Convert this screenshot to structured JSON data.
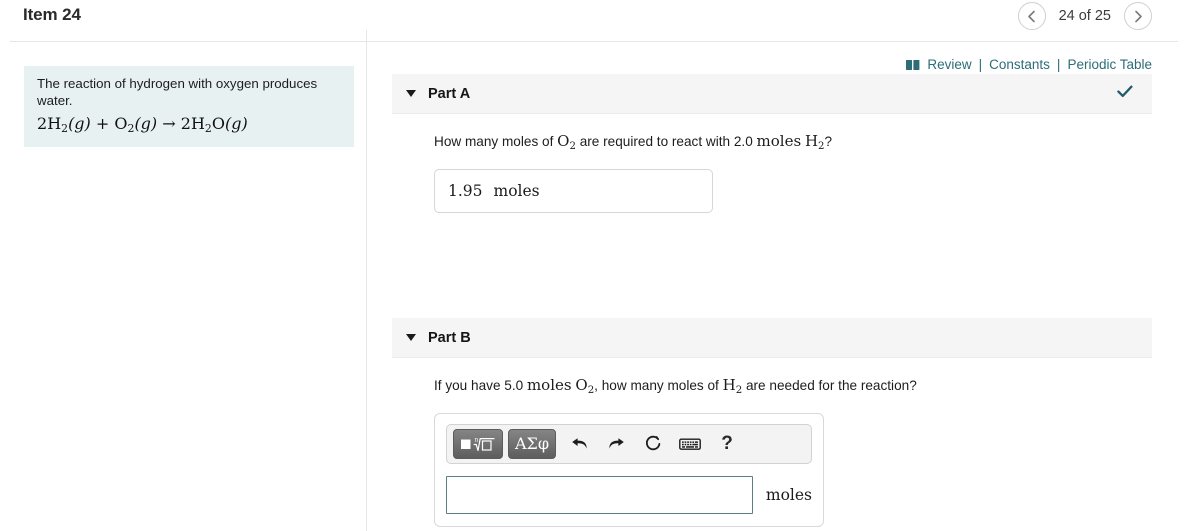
{
  "header": {
    "item_title": "Item 24",
    "prev_icon": "chevron-left-icon",
    "next_icon": "chevron-right-icon",
    "counter": "24 of 25"
  },
  "resources": {
    "book_icon": "book-icon",
    "review_label": "Review",
    "sep1": "|",
    "constants_label": "Constants",
    "sep2": "|",
    "periodic_table_label": "Periodic Table",
    "color": "#2c6d78"
  },
  "question": {
    "prompt": "The reaction of hydrogen with oxygen produces water.",
    "equation": {
      "lhs_coeff1": "2",
      "lhs_species1": "H",
      "lhs_sub1": "2",
      "lhs_state1": "(g)",
      "plus": "+",
      "lhs_species2": "O",
      "lhs_sub2": "2",
      "lhs_state2": "(g)",
      "arrow": "→",
      "rhs_coeff": "2",
      "rhs_species_h": "H",
      "rhs_sub_h": "2",
      "rhs_species_o": "O",
      "rhs_state": "(g)"
    },
    "background_color": "#e7f1f2"
  },
  "parts": [
    {
      "caret_icon": "caret-down-icon",
      "label": "Part A",
      "status_icon": "check-icon",
      "status_color": "#205c68",
      "question_pre": "How many moles of ",
      "question_species1": "O",
      "question_sub1": "2",
      "question_mid": " are required to react with 2.0 ",
      "question_moles": "moles",
      "question_species2": "H",
      "question_sub2": "2",
      "question_post": "?",
      "answer_value": "1.95",
      "answer_unit": "moles"
    },
    {
      "caret_icon": "caret-down-icon",
      "label": "Part B",
      "question_pre": "If you have 5.0 ",
      "question_moles1": "moles",
      "question_species1": "O",
      "question_sub1": "2",
      "question_mid": ", how many moles of ",
      "question_species2": "H",
      "question_sub2": "2",
      "question_post": " are needed for the reaction?",
      "toolbar": {
        "template_button_icon": "math-template-icon",
        "template_button_label": "■",
        "symbols_button_label": "ΑΣφ",
        "undo_icon": "undo-arrow-icon",
        "redo_icon": "redo-arrow-icon",
        "reset_icon": "reset-circular-arrow-icon",
        "keyboard_icon": "keyboard-icon",
        "help_icon": "question-mark-icon",
        "help_label": "?"
      },
      "answer_value": "",
      "answer_placeholder": "",
      "answer_unit": "moles",
      "input_border_color": "#5b7e84"
    }
  ]
}
